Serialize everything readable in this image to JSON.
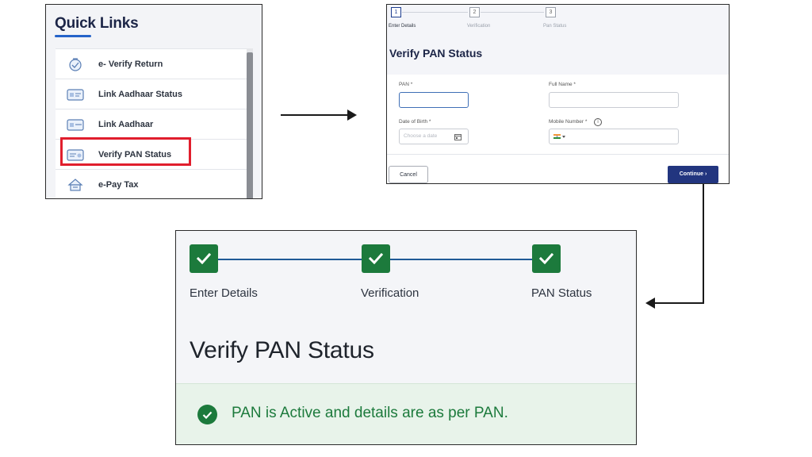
{
  "quick_links": {
    "title": "Quick Links",
    "items": [
      {
        "label": "e- Verify Return",
        "icon": "verify-return-icon"
      },
      {
        "label": "Link Aadhaar Status",
        "icon": "aadhaar-status-icon"
      },
      {
        "label": "Link Aadhaar",
        "icon": "link-aadhaar-icon"
      },
      {
        "label": "Verify PAN Status",
        "icon": "pan-card-icon",
        "highlighted": true
      },
      {
        "label": "e-Pay Tax",
        "icon": "pay-tax-icon"
      }
    ]
  },
  "form": {
    "steps": [
      {
        "number": "1",
        "label": "Enter Details",
        "active": true
      },
      {
        "number": "2",
        "label": "Verification",
        "active": false
      },
      {
        "number": "3",
        "label": "Pan Status",
        "active": false
      }
    ],
    "title": "Verify PAN Status",
    "pan_label": "PAN *",
    "full_name_label": "Full Name *",
    "dob_label": "Date of Birth *",
    "dob_placeholder": "Choose a date",
    "mobile_label": "Mobile Number *",
    "cancel_label": "Cancel",
    "continue_label": "Continue ›"
  },
  "result": {
    "steps": [
      {
        "label": "Enter Details",
        "done": true
      },
      {
        "label": "Verification",
        "done": true
      },
      {
        "label": "PAN Status",
        "done": true
      }
    ],
    "title": "Verify PAN Status",
    "message": "PAN is Active and details are as per PAN."
  },
  "colors": {
    "brand_navy": "#22357f",
    "success_green": "#1c7a3c",
    "highlight_red": "#e01e2d",
    "progress_blue": "#1f5a96"
  }
}
